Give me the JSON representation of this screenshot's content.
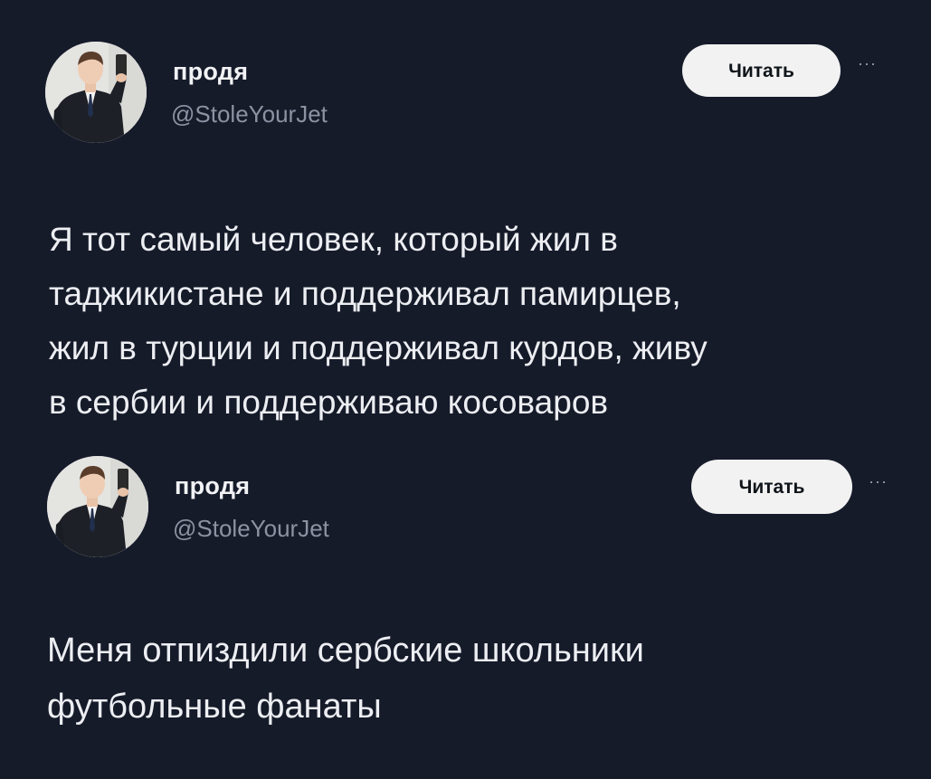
{
  "tweets": [
    {
      "display_name": "продя",
      "handle": "@StoleYourJet",
      "follow_label": "Читать",
      "more_label": "···",
      "text": "Я тот самый человек, который жил в\nтаджикистане и поддерживал памирцев,\nжил в турции и поддерживал курдов, живу\nв сербии и поддерживаю косоваров"
    },
    {
      "display_name": "продя",
      "handle": "@StoleYourJet",
      "follow_label": "Читать",
      "more_label": "···",
      "text": "Меня отпиздили сербские школьники\nфутбольные фанаты"
    }
  ]
}
